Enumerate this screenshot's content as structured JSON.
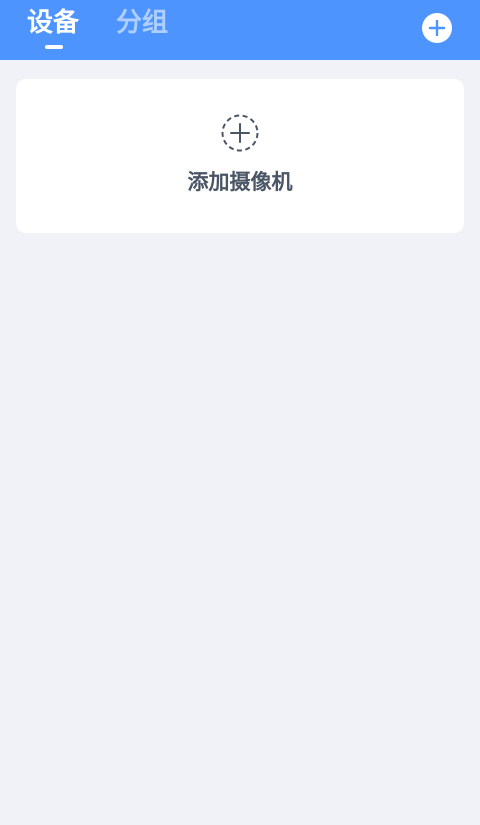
{
  "header": {
    "tabs": [
      {
        "label": "设备",
        "active": true
      },
      {
        "label": "分组",
        "active": false
      }
    ],
    "add_icon": "plus-circle-icon",
    "background_color": "#4d94ff"
  },
  "main": {
    "add_camera_card": {
      "label": "添加摄像机",
      "icon": "dashed-plus-circle-icon"
    }
  },
  "page_background": "#f0f2f7"
}
